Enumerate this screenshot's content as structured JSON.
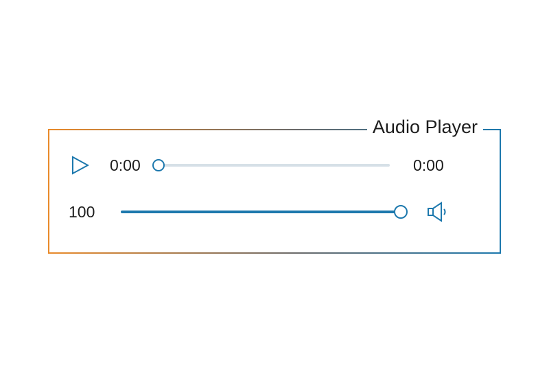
{
  "title": "Audio Player",
  "playback": {
    "current_time": "0:00",
    "total_time": "0:00",
    "progress_percent": 0
  },
  "volume": {
    "value": "100",
    "percent": 100
  },
  "colors": {
    "accent": "#1c78ad",
    "gradient_left": "#e98a2a",
    "gradient_right": "#1c78ad",
    "track_empty": "#d6e0e7"
  },
  "icons": {
    "play": "play-icon",
    "speaker": "speaker-icon"
  }
}
